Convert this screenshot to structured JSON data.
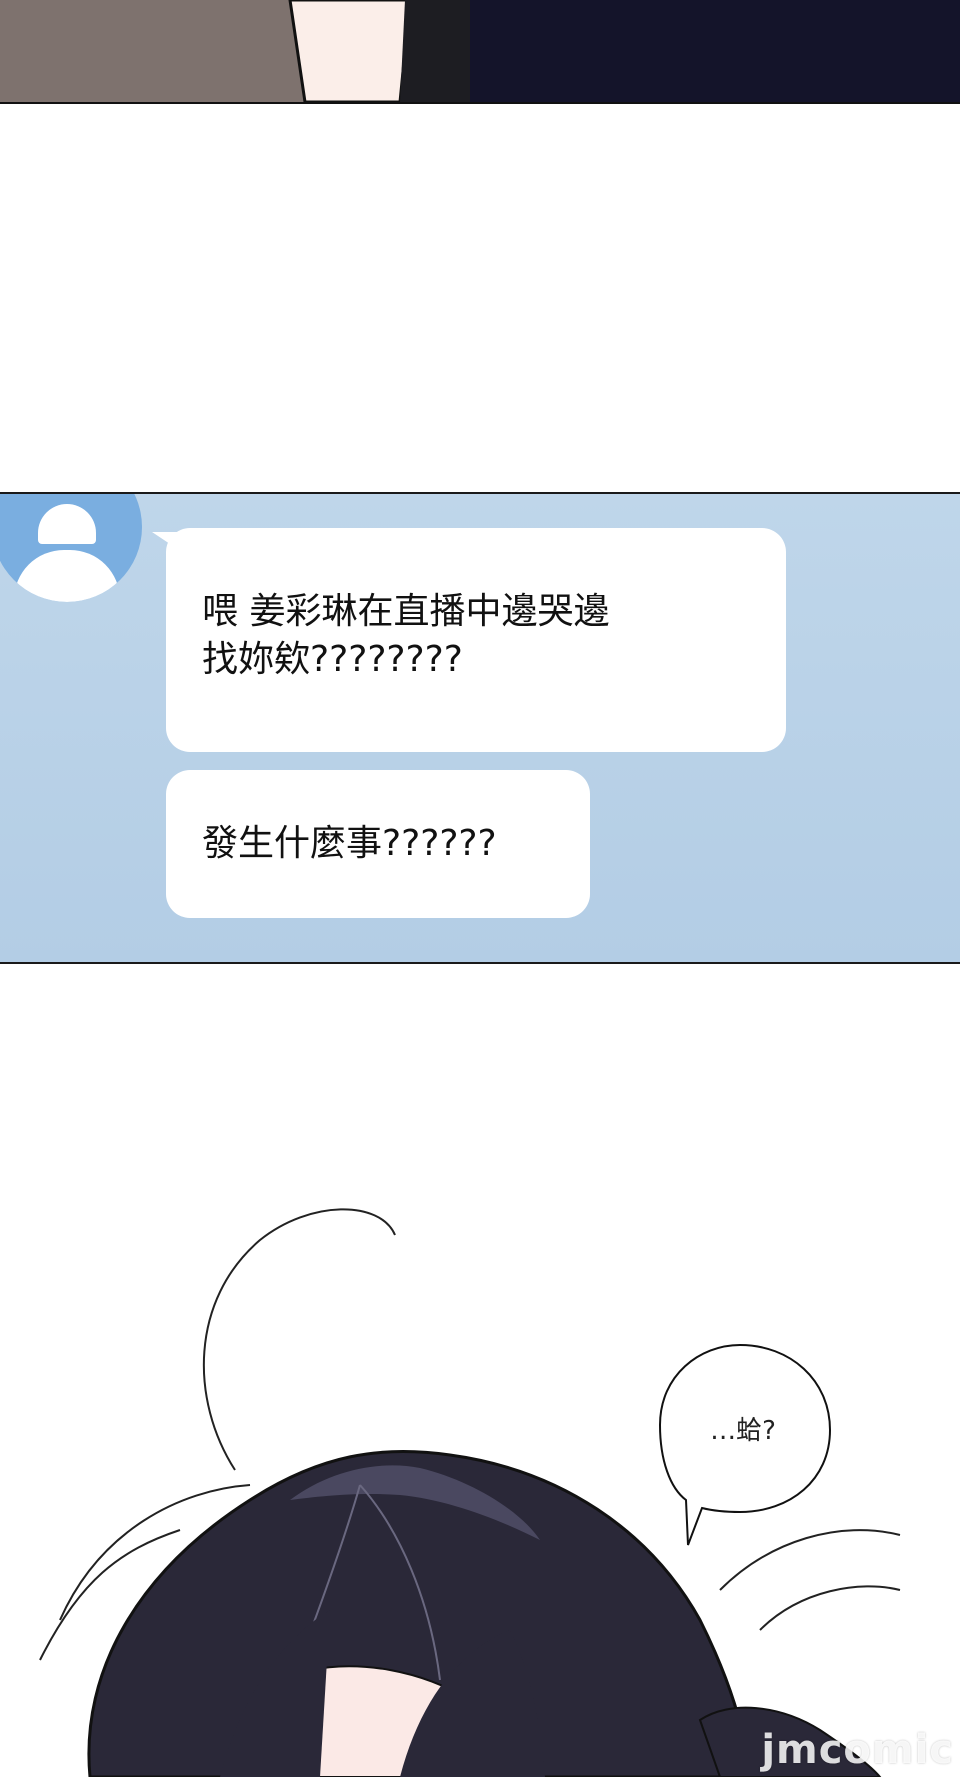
{
  "chat": {
    "message_1_line_1": "喂 姜彩琳在直播中邊哭邊",
    "message_1_line_2": "找妳欸????????",
    "message_2": "發生什麼事??????"
  },
  "speech": {
    "text": "…蛤?"
  },
  "watermark": {
    "text": "jmcomic"
  },
  "colors": {
    "chat_background": "#b9d2e8",
    "bubble": "#ffffff",
    "avatar": "#7aaee0",
    "hair": "#2a2838",
    "skin": "#fbe9e6"
  }
}
